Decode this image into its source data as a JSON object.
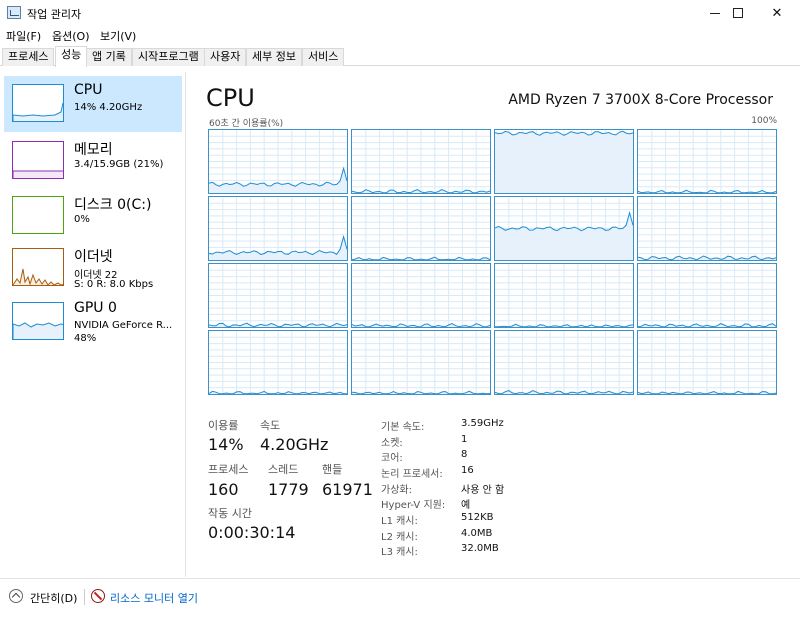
{
  "window": {
    "title": "작업 관리자"
  },
  "menu": [
    "파일(F)",
    "옵션(O)",
    "보기(V)"
  ],
  "tabs": [
    "프로세스",
    "성능",
    "앱 기록",
    "시작프로그램",
    "사용자",
    "세부 정보",
    "서비스"
  ],
  "sidebar": {
    "items": [
      {
        "title": "CPU",
        "sub1": "14% 4.20GHz",
        "sub2": "",
        "color": "#1e8cd3"
      },
      {
        "title": "메모리",
        "sub1": "3.4/15.9GB (21%)",
        "sub2": "",
        "color": "#8b2fb0"
      },
      {
        "title": "디스크 0(C:)",
        "sub1": "0%",
        "sub2": "",
        "color": "#4da30d"
      },
      {
        "title": "이더넷",
        "sub1": "이더넷 22",
        "sub2": "S: 0  R: 8.0 Kbps",
        "color": "#a75d0f"
      },
      {
        "title": "GPU 0",
        "sub1": "NVIDIA GeForce R...",
        "sub2": "48%",
        "color": "#1e8cd3"
      }
    ]
  },
  "main": {
    "title": "CPU",
    "model": "AMD Ryzen 7 3700X 8-Core Processor",
    "graph_caption": "60초 간 이용률(%)",
    "graph_max": "100%",
    "core_levels": [
      0.14,
      0.02,
      0.95,
      0.01,
      0.12,
      0.01,
      0.5,
      0.03,
      0.03,
      0.02,
      0.01,
      0.02,
      0.01,
      0.01,
      0.02,
      0.01
    ]
  },
  "stats": {
    "utilization_label": "이용률",
    "utilization": "14%",
    "speed_label": "속도",
    "speed": "4.20GHz",
    "processes_label": "프로세스",
    "processes": "160",
    "threads_label": "스레드",
    "threads": "1779",
    "handles_label": "핸들",
    "handles": "61971",
    "uptime_label": "작동 시간",
    "uptime": "0:00:30:14"
  },
  "specs": [
    {
      "label": "기본 속도:",
      "value": "3.59GHz"
    },
    {
      "label": "소켓:",
      "value": "1"
    },
    {
      "label": "코어:",
      "value": "8"
    },
    {
      "label": "논리 프로세서:",
      "value": "16"
    },
    {
      "label": "가상화:",
      "value": "사용 안 함"
    },
    {
      "label": "Hyper-V 지원:",
      "value": "예"
    },
    {
      "label": "L1 캐시:",
      "value": "512KB"
    },
    {
      "label": "L2 캐시:",
      "value": "4.0MB"
    },
    {
      "label": "L3 캐시:",
      "value": "32.0MB"
    }
  ],
  "footer": {
    "fewer": "간단히(D)",
    "resmon": "리소스 모니터 열기"
  }
}
